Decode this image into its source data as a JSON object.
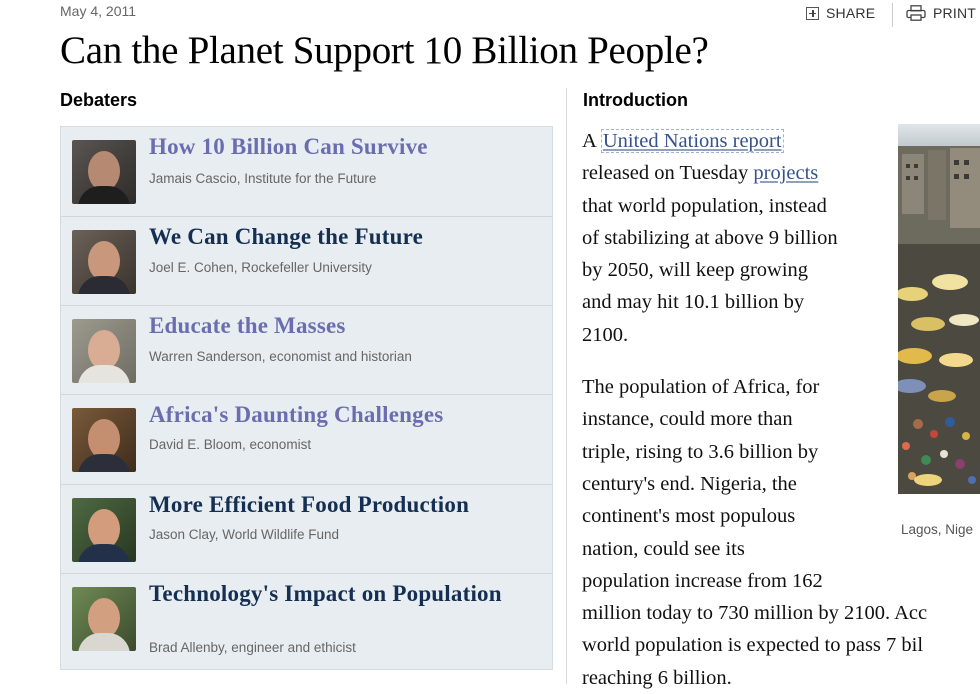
{
  "date": "May 4, 2011",
  "toolbar": {
    "share_label": "SHARE",
    "print_label": "PRINT"
  },
  "title": "Can the Planet Support 10 Billion People?",
  "debaters_heading": "Debaters",
  "intro_heading": "Introduction",
  "debaters": [
    {
      "title": "How 10 Billion Can Survive",
      "author": "Jamais Cascio, Institute for the Future",
      "link_color": "#6b6eae"
    },
    {
      "title": "We Can Change the Future",
      "author": "Joel E. Cohen, Rockefeller University",
      "link_color": "#152f52"
    },
    {
      "title": "Educate the Masses",
      "author": "Warren Sanderson, economist and historian",
      "link_color": "#6b6eae"
    },
    {
      "title": "Africa's Daunting Challenges",
      "author": "David E. Bloom, economist",
      "link_color": "#6b6eae"
    },
    {
      "title": "More Efficient Food Production",
      "author": "Jason Clay, World Wildlife Fund",
      "link_color": "#152f52"
    },
    {
      "title": "Technology's Impact on Population",
      "author": "Brad Allenby, engineer and ethicist",
      "link_color": "#152f52"
    }
  ],
  "intro": {
    "p1": {
      "t1": "A",
      "link1": "United Nations report",
      "t2": "released on Tuesday",
      "link2": "projects",
      "t3": "that world population, instead",
      "t4": "of stabilizing at above 9 billion",
      "t5": "by 2050, will keep growing",
      "t6": "and may hit 10.1 billion by",
      "t7": "2100."
    },
    "p2": [
      "The population of Africa, for",
      "instance, could more than",
      "triple, rising to 3.6 billion by",
      "century's end. Nigeria, the",
      "continent's most populous",
      "nation, could see its",
      "population increase from 162",
      "million today to 730 million by 2100. Acc",
      "world population is expected to pass 7 bil",
      "reaching 6 billion."
    ]
  },
  "photo_caption": "Lagos, Nige",
  "colors": {
    "lavender_link": "#6b6eae",
    "navy_link": "#152f52",
    "body_link": "#34528c",
    "panel_bg": "#e7edf1"
  }
}
